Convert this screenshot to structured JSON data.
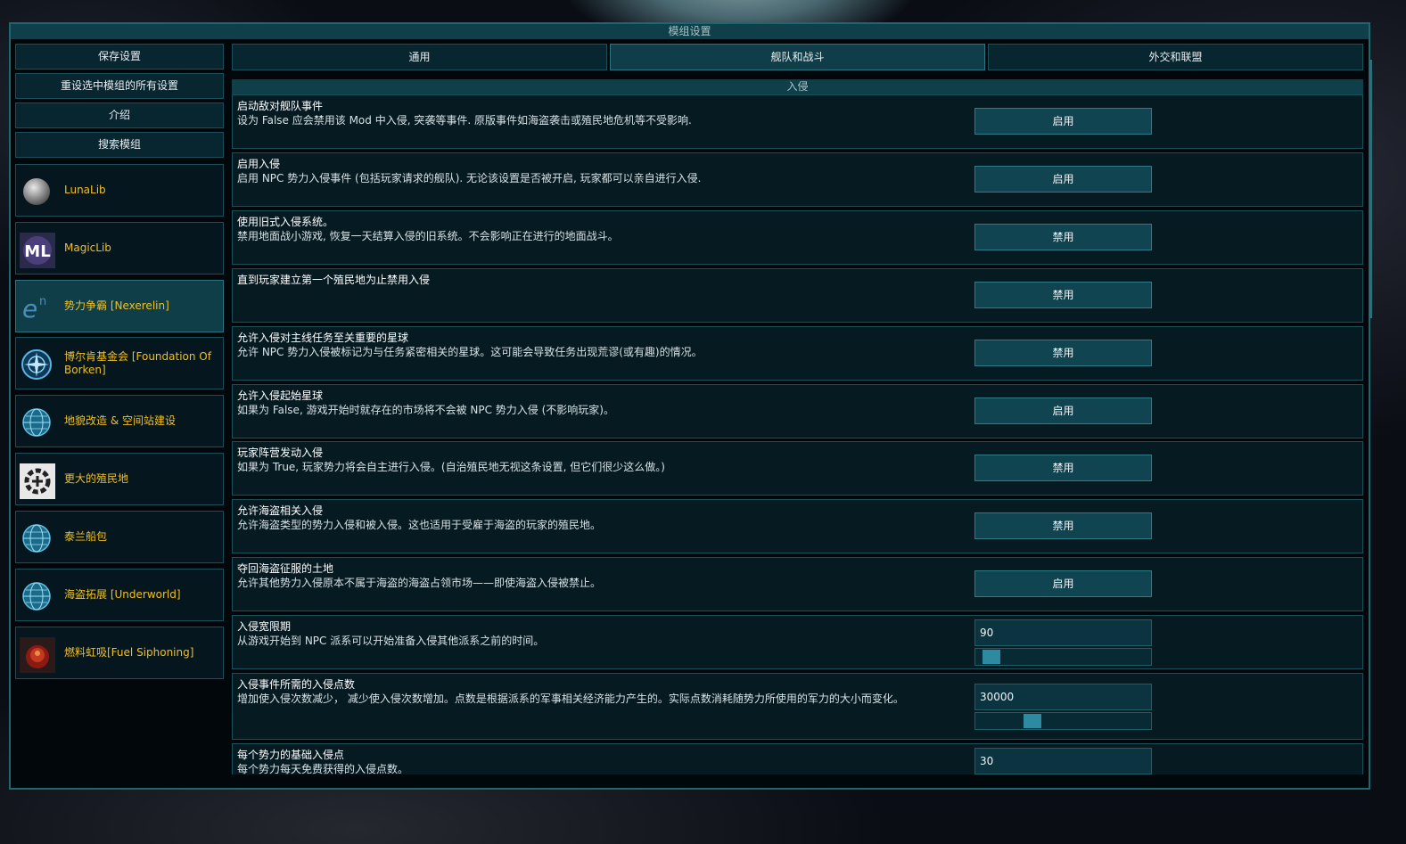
{
  "window": {
    "title": "模组设置"
  },
  "left_buttons": [
    "保存设置",
    "重设选中模组的所有设置",
    "介绍",
    "搜索模组"
  ],
  "mods": [
    {
      "name": "LunaLib",
      "icon": "moon-icon"
    },
    {
      "name": "MagicLib",
      "icon": "magiclib-icon"
    },
    {
      "name": "势力争霸 [Nexerelin]",
      "icon": "nexerelin-icon",
      "selected": true
    },
    {
      "name": "博尔肯基金会 [Foundation Of Borken]",
      "icon": "compass-emblem-icon"
    },
    {
      "name": "地貌改造 & 空间站建设",
      "icon": "globe-icon"
    },
    {
      "name": "更大的殖民地",
      "icon": "gear-plus-icon"
    },
    {
      "name": "泰兰船包",
      "icon": "globe-icon"
    },
    {
      "name": "海盗拓展 [Underworld]",
      "icon": "globe-icon"
    },
    {
      "name": "燃料虹吸[Fuel Siphoning]",
      "icon": "fuel-siphon-icon"
    }
  ],
  "tabs": [
    {
      "label": "通用",
      "selected": false
    },
    {
      "label": "舰队和战斗",
      "selected": true
    },
    {
      "label": "外交和联盟",
      "selected": false
    }
  ],
  "section": "入侵",
  "settings": [
    {
      "title": "启动敌对舰队事件",
      "desc": "设为 False 应会禁用该 Mod 中入侵, 突袭等事件. 原版事件如海盗袭击或殖民地危机等不受影响.",
      "type": "button",
      "value": "启用"
    },
    {
      "title": "启用入侵",
      "desc": "启用 NPC 势力入侵事件 (包括玩家请求的舰队). 无论该设置是否被开启, 玩家都可以亲自进行入侵.",
      "type": "button",
      "value": "启用"
    },
    {
      "title": "使用旧式入侵系统。",
      "desc": "禁用地面战小游戏, 恢复一天结算入侵的旧系统。不会影响正在进行的地面战斗。",
      "type": "button",
      "value": "禁用"
    },
    {
      "title": "直到玩家建立第一个殖民地为止禁用入侵",
      "desc": "",
      "type": "button",
      "value": "禁用"
    },
    {
      "title": "允许入侵对主线任务至关重要的星球",
      "desc": "允许 NPC 势力入侵被标记为与任务紧密相关的星球。这可能会导致任务出现荒谬(或有趣)的情况。",
      "type": "button",
      "value": "禁用"
    },
    {
      "title": "允许入侵起始星球",
      "desc": "如果为 False, 游戏开始时就存在的市场将不会被 NPC 势力入侵 (不影响玩家)。",
      "type": "button",
      "value": "启用"
    },
    {
      "title": "玩家阵营发动入侵",
      "desc": "如果为 True, 玩家势力将会自主进行入侵。(自治殖民地无视这条设置, 但它们很少这么做。)",
      "type": "button",
      "value": "禁用"
    },
    {
      "title": "允许海盗相关入侵",
      "desc": "允许海盗类型的势力入侵和被入侵。这也适用于受雇于海盗的玩家的殖民地。",
      "type": "button",
      "value": "禁用"
    },
    {
      "title": "夺回海盗征服的土地",
      "desc": "允许其他势力入侵原本不属于海盗的海盗占领市场——即使海盗入侵被禁止。",
      "type": "button",
      "value": "启用"
    },
    {
      "title": "入侵宽限期",
      "desc": "从游戏开始到 NPC 派系可以开始准备入侵其他派系之前的时间。",
      "type": "slider",
      "value": "90",
      "level": 0.04
    },
    {
      "title": "入侵事件所需的入侵点数",
      "desc": "增加使入侵次数减少， 减少使入侵次数增加。点数是根据派系的军事相关经济能力产生的。实际点数消耗随势力所使用的军力的大小而变化。",
      "type": "slider",
      "value": "30000",
      "level": 0.3
    },
    {
      "title": "每个势力的基础入侵点",
      "desc": "每个势力每天免费获得的入侵点数。",
      "type": "field",
      "value": "30"
    }
  ]
}
